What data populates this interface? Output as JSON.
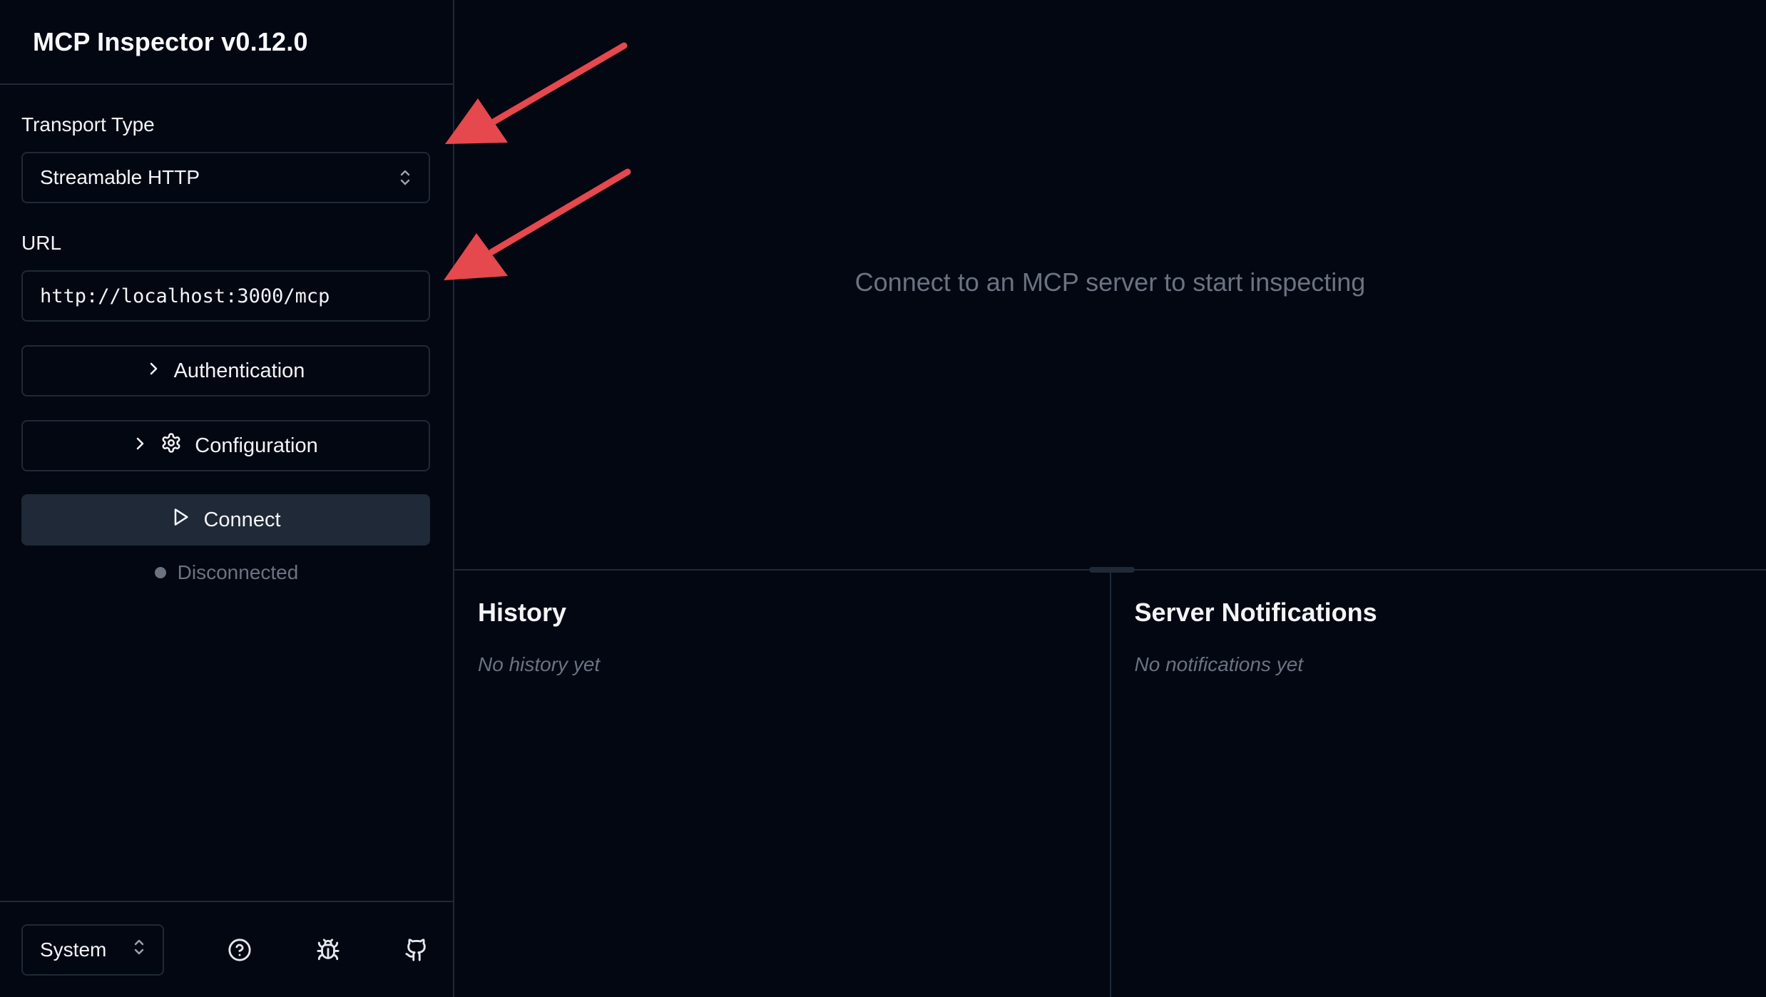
{
  "app": {
    "title": "MCP Inspector v0.12.0"
  },
  "sidebar": {
    "transport_label": "Transport Type",
    "transport_value": "Streamable HTTP",
    "url_label": "URL",
    "url_value": "http://localhost:3000/mcp",
    "auth_label": "Authentication",
    "config_label": "Configuration",
    "connect_label": "Connect",
    "status_text": "Disconnected",
    "theme_value": "System",
    "footer_icons": [
      "help-icon",
      "bug-icon",
      "github-icon"
    ]
  },
  "main": {
    "empty_message": "Connect to an MCP server to start inspecting",
    "history": {
      "title": "History",
      "empty": "No history yet"
    },
    "notifications": {
      "title": "Server Notifications",
      "empty": "No notifications yet"
    }
  },
  "colors": {
    "background": "#030712",
    "border": "#1f2937",
    "muted_text": "#6b7280",
    "annotation_arrow": "#e5484d"
  }
}
